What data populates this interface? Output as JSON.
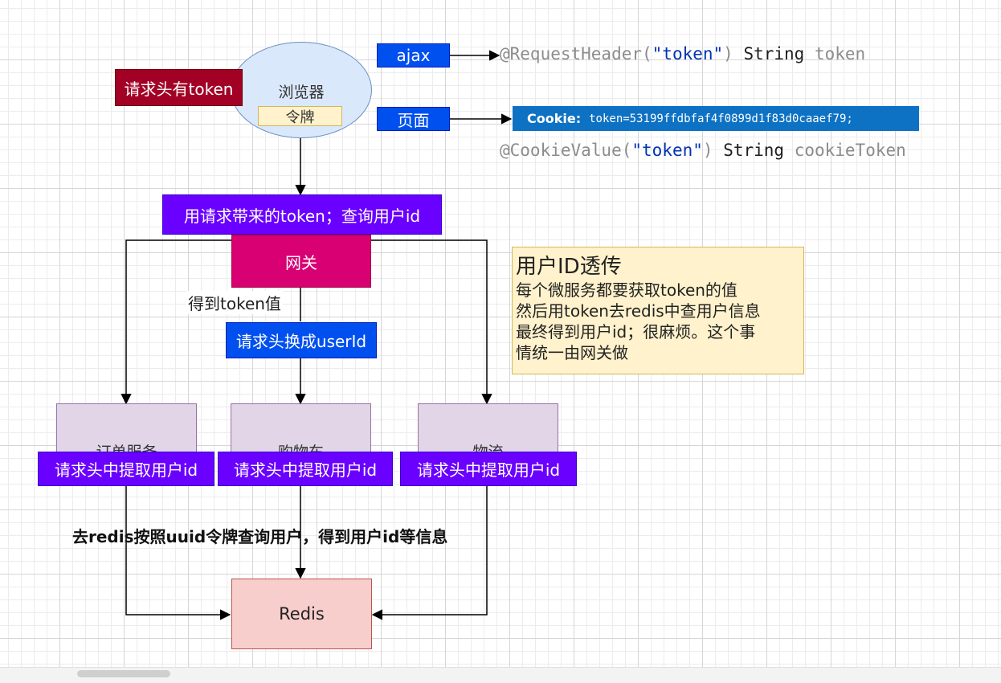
{
  "nodes": {
    "header_token_label": "请求头有token",
    "browser": "浏览器",
    "token": "令牌",
    "ajax": "ajax",
    "page": "页面",
    "query_user": "用请求带来的token；查询用户id",
    "gateway": "网关",
    "get_token_value": "得到token值",
    "swap_header": "请求头换成userId",
    "order_service": "订单服务",
    "cart_service": "购物车",
    "logistics_service": "物流",
    "extract_header": "请求头中提取用户id",
    "redis": "Redis",
    "redis_query_note": "去redis按照uuid令牌查询用户，得到用户id等信息"
  },
  "code": {
    "request_header": {
      "prefix": "@RequestHeader(",
      "arg": "\"token\"",
      "close": ")",
      "type": " String ",
      "var": "token"
    },
    "cookie": {
      "label": "Cookie:",
      "value": "token=53199ffdbfaf4f0899d1f83d0caaef79;"
    },
    "cookie_value": {
      "prefix": "@CookieValue(",
      "arg": "\"token\"",
      "close": ")",
      "type": " String ",
      "var": "cookieToken"
    }
  },
  "note": {
    "title": "用户ID透传",
    "lines": [
      "每个微服务都要获取token的值",
      "然后用token去redis中查用户信息",
      "最终得到用户id；很麻烦。这个事",
      "情统一由网关做"
    ]
  },
  "colors": {
    "dark_red": "#a20025",
    "purple": "#6a00ff",
    "magenta": "#d80073",
    "blue": "#0050ef",
    "service_fill": "#e1d5e7",
    "redis_fill": "#f8cecc",
    "note_fill": "#fff2cc",
    "browser_fill": "#dae8fc",
    "cookie_bar": "#0e72c4"
  }
}
